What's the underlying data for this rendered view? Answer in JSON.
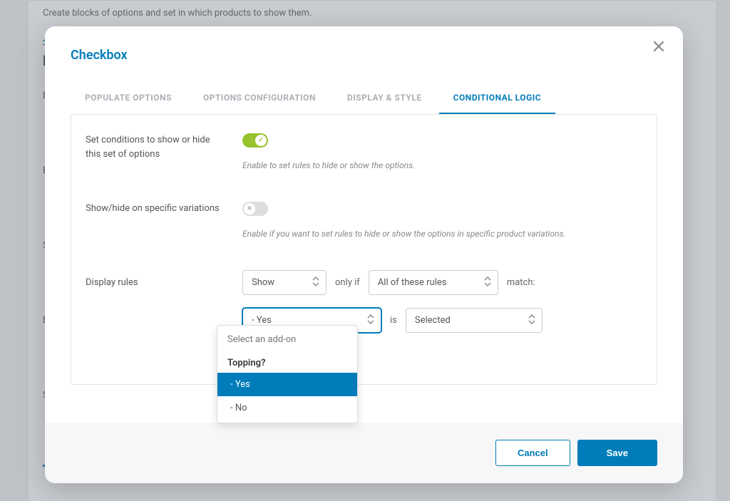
{
  "background": {
    "description": "Create blocks of options and set in which products to show them.",
    "back_link": "< Ba",
    "heading": "Edi",
    "labels": [
      "Bloc",
      "Bloc",
      "Sho\nopti",
      "Excl",
      "Sho"
    ]
  },
  "modal": {
    "title": "Checkbox",
    "tabs": [
      {
        "label": "POPULATE OPTIONS",
        "active": false
      },
      {
        "label": "OPTIONS CONFIGURATION",
        "active": false
      },
      {
        "label": "DISPLAY & STYLE",
        "active": false
      },
      {
        "label": "CONDITIONAL LOGIC",
        "active": true
      }
    ],
    "conditions": {
      "label": "Set conditions to show or hide this set of options",
      "helper": "Enable to set rules to hide or show the options."
    },
    "variations": {
      "label": "Show/hide on specific variations",
      "helper": "Enable if you want to set rules to hide or show the options in specific product variations."
    },
    "display_rules": {
      "label": "Display rules",
      "action_value": "Show",
      "only_if": "only if",
      "match_mode": "All of these rules",
      "match_suffix": "match:",
      "addon_value": "- Yes",
      "is_text": "is",
      "state_value": "Selected"
    },
    "dropdown": {
      "placeholder": "Select an add-on",
      "group": "Topping?",
      "options": [
        {
          "label": "- Yes",
          "selected": true
        },
        {
          "label": "- No",
          "selected": false
        }
      ]
    },
    "footer": {
      "cancel": "Cancel",
      "save": "Save"
    }
  }
}
